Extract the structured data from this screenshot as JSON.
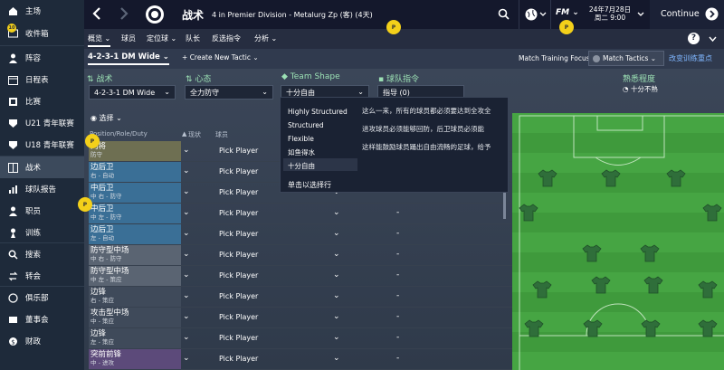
{
  "sidebar": {
    "items": [
      {
        "label": "主场",
        "icon": "home-icon"
      },
      {
        "label": "收件箱",
        "icon": "inbox-icon"
      },
      {
        "label": "阵容",
        "icon": "squad-icon"
      },
      {
        "label": "日程表",
        "icon": "calendar-icon"
      },
      {
        "label": "比赛",
        "icon": "match-icon"
      },
      {
        "label": "U21 青年联赛",
        "icon": "u21-icon"
      },
      {
        "label": "U18 青年联赛",
        "icon": "u18-icon"
      },
      {
        "label": "战术",
        "icon": "tactics-icon"
      },
      {
        "label": "球队报告",
        "icon": "report-icon"
      },
      {
        "label": "职员",
        "icon": "staff-icon"
      },
      {
        "label": "训练",
        "icon": "training-icon"
      },
      {
        "label": "搜索",
        "icon": "search-icon"
      },
      {
        "label": "转会",
        "icon": "transfer-icon"
      },
      {
        "label": "俱乐部",
        "icon": "club-icon"
      },
      {
        "label": "董事会",
        "icon": "board-icon"
      },
      {
        "label": "财政",
        "icon": "finance-icon"
      }
    ],
    "inbox_badge": "10"
  },
  "topbar": {
    "title": "战术",
    "subtitle": "4 in Premier Division - Metalurg Zp (客) (4天)",
    "date_line1": "24年7月28日",
    "date_line2": "周二 9:00",
    "continue_label": "Continue",
    "fm_label": "FM"
  },
  "subbar": {
    "tabs": [
      "概览",
      "球员",
      "定位球",
      "队长",
      "反选指令",
      "分析"
    ],
    "help": "?"
  },
  "tacbar": {
    "formation": "4-2-3-1 DM Wide",
    "create_label": "Create New Tactic",
    "training_focus": "Match Training Focus",
    "match_tactics": "Match Tactics",
    "reset_link": "改变训练重点"
  },
  "settings": {
    "tactic_label": "战术",
    "tactic_value": "4-2-3-1 DM Wide",
    "mentality_label": "心态",
    "mentality_value": "全力防守",
    "shape_label": "Team Shape",
    "shape_value": "十分自由",
    "instr_label": "球队指令",
    "instr_value": "指导 (0)",
    "familiarity_label": "熟悉程度",
    "familiarity_value": "十分不熟"
  },
  "table": {
    "select_label": "选择",
    "headers": {
      "position": "Position/Role/Duty",
      "status": "现状",
      "player": "球员"
    },
    "rows": [
      {
        "role": "门将",
        "duty": "防守",
        "color": "#6e6f52",
        "player": "Pick Player"
      },
      {
        "role": "边后卫",
        "duty": "右 - 自动",
        "color": "#3a6f96",
        "player": "Pick Player"
      },
      {
        "role": "中后卫",
        "duty": "中 右 - 防守",
        "color": "#3a6f96",
        "player": "Pick Player"
      },
      {
        "role": "中后卫",
        "duty": "中 左 - 防守",
        "color": "#3a6f96",
        "player": "Pick Player"
      },
      {
        "role": "边后卫",
        "duty": "左 - 自动",
        "color": "#3a6f96",
        "player": "Pick Player"
      },
      {
        "role": "防守型中场",
        "duty": "中 右 - 防守",
        "color": "#5a6472",
        "player": "Pick Player"
      },
      {
        "role": "防守型中场",
        "duty": "中 左 - 策应",
        "color": "#5a6472",
        "player": "Pick Player"
      },
      {
        "role": "边锋",
        "duty": "右 - 策应",
        "color": "#3f4a5a",
        "player": "Pick Player"
      },
      {
        "role": "攻击型中场",
        "duty": "中 - 策应",
        "color": "#3f4a5a",
        "player": "Pick Player"
      },
      {
        "role": "边锋",
        "duty": "左 - 策应",
        "color": "#3f4a5a",
        "player": "Pick Player"
      },
      {
        "role": "突前前锋",
        "duty": "中 - 进攻",
        "color": "#5c4a7a",
        "player": "Pick Player"
      }
    ],
    "dash": "-"
  },
  "shape_menu": {
    "options": [
      "Highly Structured",
      "Structured",
      "Flexible",
      "如鱼得水",
      "十分自由"
    ],
    "selected": "十分自由",
    "desc1": "这么一来，所有的球员都必须要达到全攻全",
    "desc2": "进攻球员必须能够回防，后卫球员必须能",
    "desc3": "这样能鼓励球员踊出自由流畅的足球，给予",
    "select_hint": "单击以选择行"
  },
  "hints": {
    "dot": "P"
  },
  "colors": {
    "accent": "#f3d01a",
    "pitch": "#3f9a3c",
    "shirt": "#2f6e3a"
  }
}
